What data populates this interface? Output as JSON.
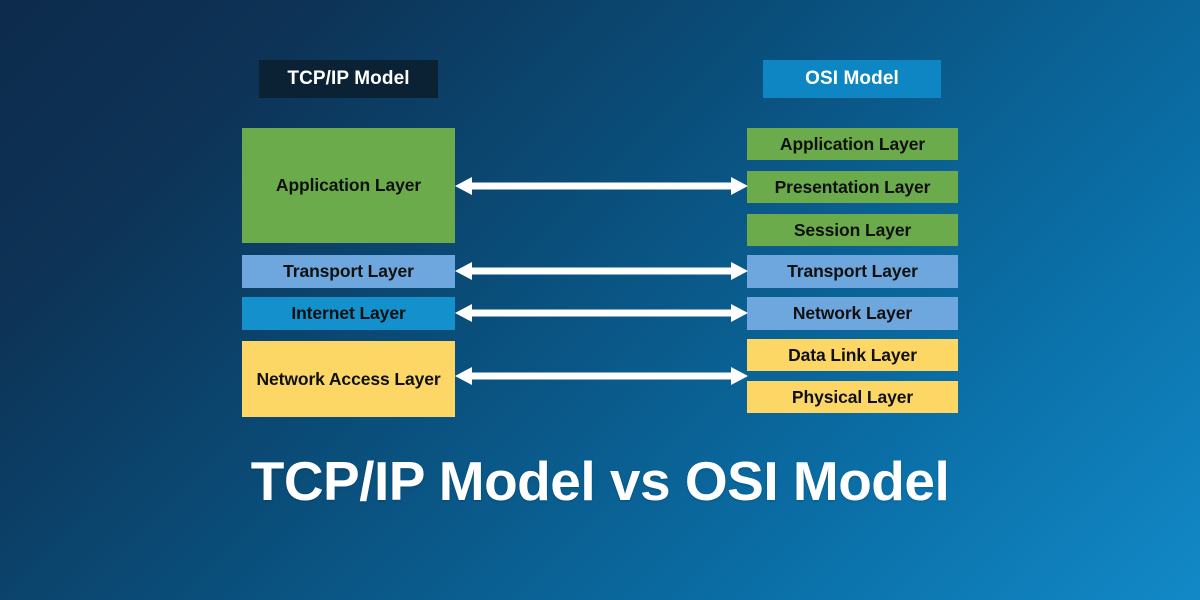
{
  "title": "TCP/IP Model vs OSI Model",
  "colors": {
    "bg_top_left": "#0d2b4c",
    "bg_bottom_right": "#1289c7",
    "header_tcp_bg": "#0b2134",
    "header_osi_bg": "#0e86c4",
    "layer_green": "#6cab4b",
    "layer_blue": "#6ea7dd",
    "layer_cyan": "#1490cd",
    "layer_yellow": "#fcd765",
    "arrow": "#ffffff",
    "text_light": "#ffffff",
    "text_dark": "#101010"
  },
  "columns": {
    "tcpip": {
      "header": "TCP/IP Model",
      "layers": [
        {
          "label": "Application Layer",
          "color": "#6cab4b"
        },
        {
          "label": "Transport Layer",
          "color": "#6ea7dd"
        },
        {
          "label": "Internet Layer",
          "color": "#1490cd"
        },
        {
          "label": "Network Access Layer",
          "color": "#fcd765"
        }
      ]
    },
    "osi": {
      "header": "OSI Model",
      "layers": [
        {
          "label": "Application Layer",
          "color": "#6cab4b"
        },
        {
          "label": "Presentation Layer",
          "color": "#6cab4b"
        },
        {
          "label": "Session Layer",
          "color": "#6cab4b"
        },
        {
          "label": "Transport Layer",
          "color": "#6ea7dd"
        },
        {
          "label": "Network Layer",
          "color": "#6ea7dd"
        },
        {
          "label": "Data Link Layer",
          "color": "#fcd765"
        },
        {
          "label": "Physical Layer",
          "color": "#fcd765"
        }
      ]
    }
  },
  "mappings": [
    {
      "icon": "double-arrow-icon",
      "from": "Application Layer",
      "to": "Application Layer / Presentation Layer / Session Layer"
    },
    {
      "icon": "double-arrow-icon",
      "from": "Transport Layer",
      "to": "Transport Layer"
    },
    {
      "icon": "double-arrow-icon",
      "from": "Internet Layer",
      "to": "Network Layer"
    },
    {
      "icon": "double-arrow-icon",
      "from": "Network Access Layer",
      "to": "Data Link Layer / Physical Layer"
    }
  ]
}
